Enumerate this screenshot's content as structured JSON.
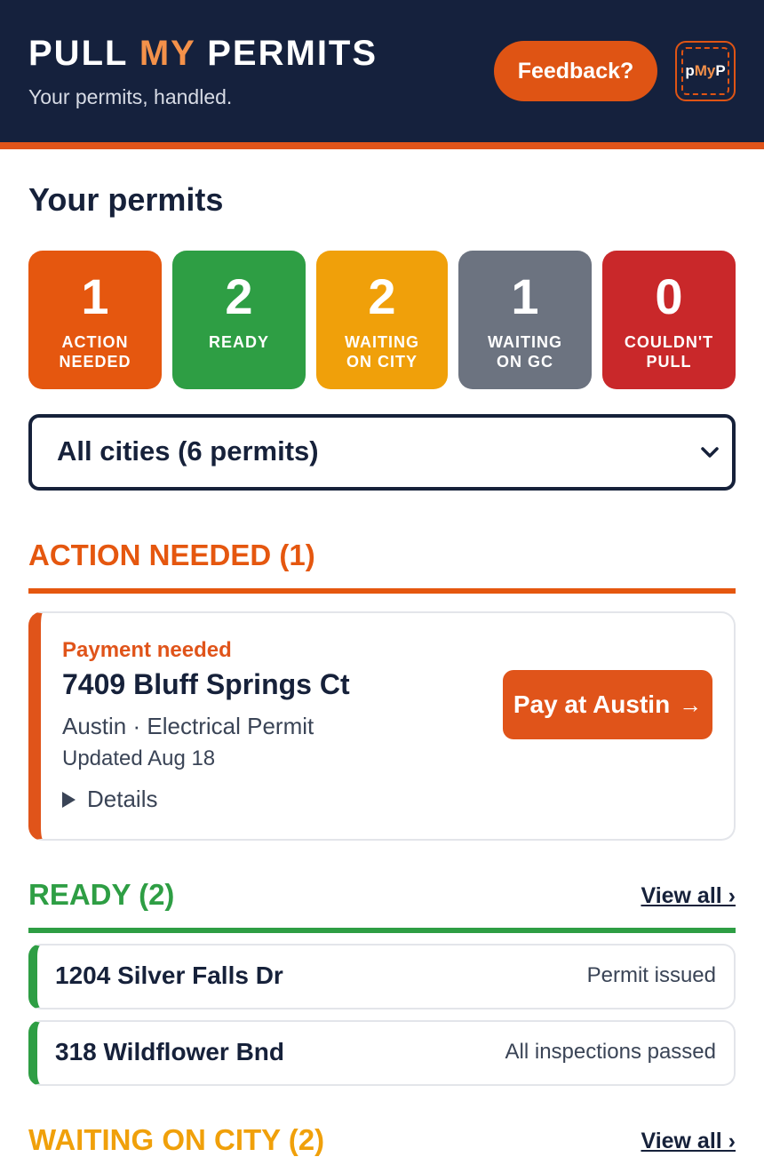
{
  "header": {
    "brand_part1": "PULL",
    "brand_part2": "MY",
    "brand_part3": "PERMITS",
    "tagline": "Your permits, handled.",
    "feedback_label": "Feedback?",
    "logo_p1": "p",
    "logo_p2": "My",
    "logo_p3": "P"
  },
  "page": {
    "title": "Your permits"
  },
  "status_tiles": [
    {
      "count": "1",
      "label": "ACTION\nNEEDED",
      "color": "#e5570f"
    },
    {
      "count": "2",
      "label": "READY",
      "color": "#2e9e44"
    },
    {
      "count": "2",
      "label": "WAITING\nON CITY",
      "color": "#f0a00a"
    },
    {
      "count": "1",
      "label": "WAITING\nON GC",
      "color": "#6c7380"
    },
    {
      "count": "0",
      "label": "COULDN'T\nPULL",
      "color": "#c9282a"
    }
  ],
  "city_filter": {
    "selected": "All cities (6 permits)"
  },
  "groups": {
    "action_needed": {
      "title": "ACTION NEEDED (1)",
      "color": "#e5570f",
      "card": {
        "status": "Payment needed",
        "address": "7409 Bluff Springs Ct",
        "city": "Austin",
        "separator": "·",
        "permit_type": "Electrical Permit",
        "updated": "Updated Aug 18",
        "details_label": "Details",
        "pay_label": "Pay at Austin",
        "pay_arrow": "→"
      }
    },
    "ready": {
      "title": "READY (2)",
      "color": "#2e9e44",
      "view_all": "View all ›",
      "rows": [
        {
          "address": "1204 Silver Falls Dr",
          "status": "Permit issued"
        },
        {
          "address": "318 Wildflower Bnd",
          "status": "All inspections passed"
        }
      ]
    },
    "waiting_on_city": {
      "title": "WAITING ON CITY (2)",
      "color": "#f0a00a",
      "view_all": "View all ›"
    }
  }
}
